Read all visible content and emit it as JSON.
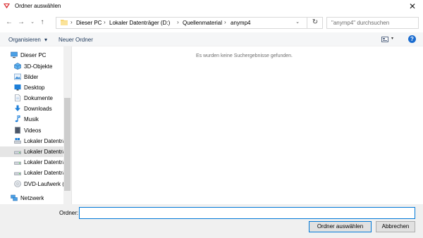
{
  "window": {
    "title": "Ordner auswählen",
    "close": "✕"
  },
  "nav": {
    "back": "←",
    "forward": "→",
    "up": "↑",
    "refresh": "↻",
    "dropdown": "⌄"
  },
  "breadcrumb": {
    "items": [
      "Dieser PC",
      "Lokaler Datenträger (D:)",
      "Quellenmaterial",
      "anymp4"
    ],
    "separator": "›"
  },
  "search": {
    "placeholder": "\"anymp4\" durchsuchen"
  },
  "toolbar": {
    "organize": "Organisieren",
    "organize_arrow": "▾",
    "new_folder": "Neuer Ordner",
    "view_arrow": "▾",
    "help": "?"
  },
  "sidebar": {
    "items": [
      {
        "label": "Dieser PC",
        "icon": "computer-icon"
      },
      {
        "label": "3D-Objekte",
        "icon": "3d-objects-icon"
      },
      {
        "label": "Bilder",
        "icon": "pictures-icon"
      },
      {
        "label": "Desktop",
        "icon": "desktop-icon"
      },
      {
        "label": "Dokumente",
        "icon": "documents-icon"
      },
      {
        "label": "Downloads",
        "icon": "download-icon"
      },
      {
        "label": "Musik",
        "icon": "music-icon"
      },
      {
        "label": "Videos",
        "icon": "videos-icon"
      },
      {
        "label": "Lokaler Datenträ",
        "icon": "drive-icon"
      },
      {
        "label": "Lokaler Datenträ",
        "icon": "drive-icon",
        "selected": true
      },
      {
        "label": "Lokaler Datenträ",
        "icon": "drive-icon"
      },
      {
        "label": "Lokaler Datenträ",
        "icon": "drive-icon"
      },
      {
        "label": "DVD-Laufwerk (",
        "icon": "dvd-icon"
      },
      {
        "label": "Netzwerk",
        "icon": "network-icon"
      }
    ]
  },
  "content": {
    "empty_message": "Es wurden keine Suchergebnisse gefunden."
  },
  "footer": {
    "folder_label": "Ordner:",
    "folder_value": "",
    "select_button": "Ordner auswählen",
    "cancel_button": "Abbrechen"
  },
  "colors": {
    "accent": "#0078d7",
    "link": "#1e395b",
    "selected_bg": "#e5e5e5"
  }
}
